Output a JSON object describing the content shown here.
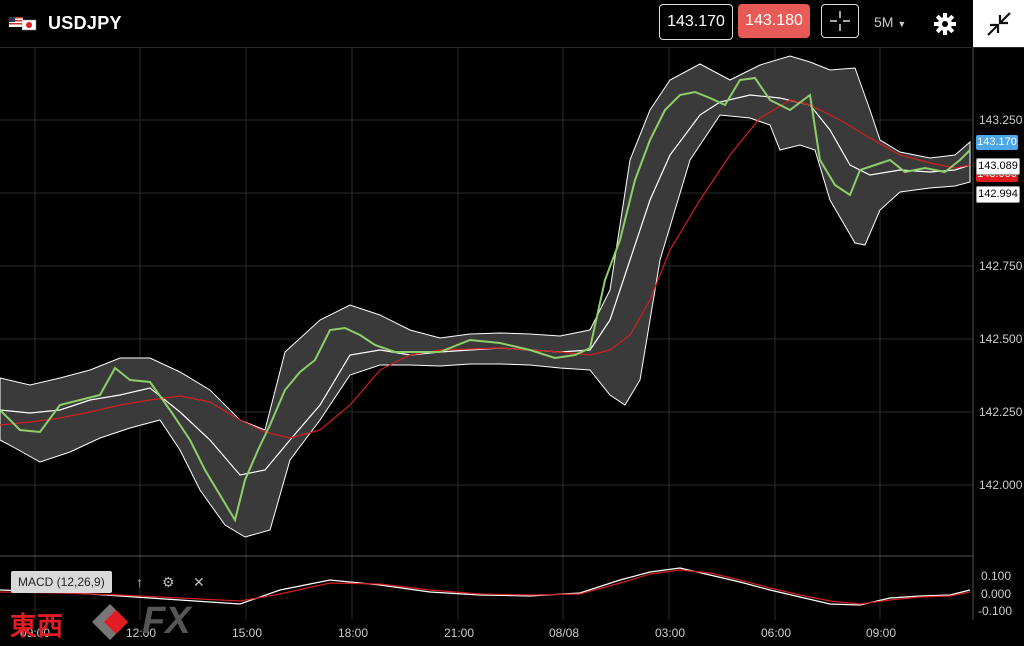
{
  "header": {
    "flag_icon": "us-jp-flag-icon",
    "symbol": "USDJPY",
    "bid": "143.170",
    "ask": "143.180",
    "crosshair_icon": "crosshair-icon",
    "timeframe": "5M",
    "settings_icon": "gear-icon",
    "collapse_icon": "collapse-icon",
    "colors": {
      "ask_bg": "#e85a55",
      "bid_border": "#dddddd"
    }
  },
  "price_axis": {
    "ticks": [
      "143.250",
      "143.000",
      "142.750",
      "142.500",
      "142.250",
      "142.000"
    ],
    "tags": {
      "current": "143.170",
      "upper_band": "143.089",
      "ma": "143.000",
      "lower_band": "142.994"
    },
    "colors": {
      "current": "#4da6e8",
      "ma": "#e01b1b"
    }
  },
  "macd": {
    "label": "MACD (12,26,9)",
    "up_icon": "arrow-up-icon",
    "settings_icon": "gear-icon",
    "close_icon": "close-icon",
    "ticks": [
      "0.100",
      "0.000",
      "-0.100"
    ]
  },
  "time_axis": {
    "labels": [
      "09:00",
      "12:00",
      "15:00",
      "18:00",
      "21:00",
      "08/08",
      "03:00",
      "06:00",
      "09:00"
    ]
  },
  "logo": {
    "kanji": "東西",
    "fx": "FX"
  },
  "chart_data": {
    "type": "line",
    "symbol": "USDJPY",
    "timeframe": "5M",
    "ylim": [
      141.75,
      143.45
    ],
    "x": [
      "09:00",
      "12:00",
      "15:00",
      "18:00",
      "21:00",
      "08/08",
      "03:00",
      "06:00",
      "09:00"
    ],
    "series": [
      {
        "values": [
          142.2,
          142.4,
          142.05,
          142.6,
          142.48,
          142.45,
          143.35,
          143.25,
          143.1
        ]
      },
      {
        "values": [
          142.15,
          142.25,
          142.15,
          142.45,
          142.48,
          142.48,
          142.7,
          143.25,
          143.0
        ]
      }
    ],
    "macd_ylim": [
      -0.12,
      0.12
    ]
  }
}
